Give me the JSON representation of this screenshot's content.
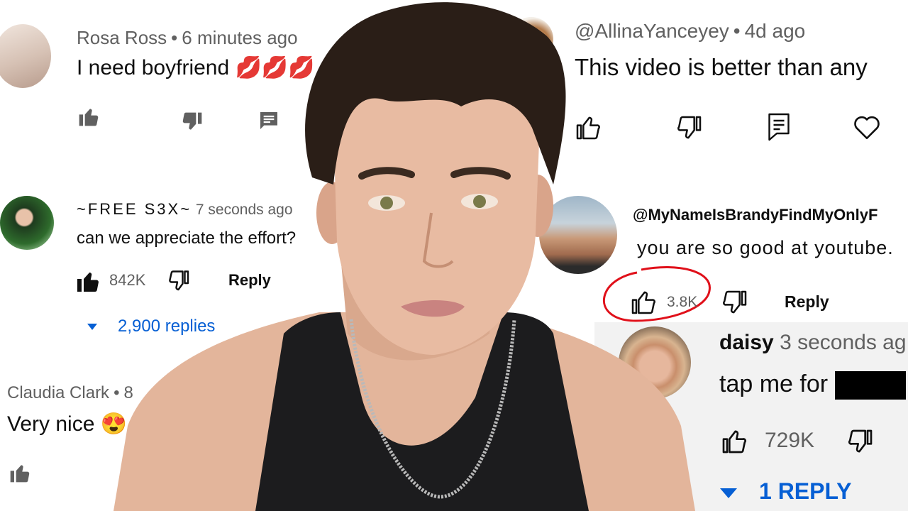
{
  "comments": {
    "c1": {
      "author": "Rosa Ross",
      "time": "6 minutes ago",
      "text": "I need boyfriend",
      "emoji": "💋💋💋"
    },
    "c2": {
      "author": "~FREE S3X~",
      "time": "7 seconds ago",
      "text": "can we appreciate the effort?",
      "likes": "842K",
      "reply_label": "Reply",
      "replies_label": "2,900 replies"
    },
    "c3": {
      "author": "Claudia Clark",
      "time": "8",
      "text": "Very nice",
      "emoji": "😍"
    },
    "c4": {
      "author": "@AllinaYanceyey",
      "time": "4d ago",
      "text": "This video is better than any"
    },
    "c5": {
      "author": "@MyNameIsBrandyFindMyOnlyF",
      "text": "you are so good at youtube.",
      "likes": "3.8K",
      "reply_label": "Reply"
    },
    "c6": {
      "author": "daisy",
      "time": "3 seconds ag",
      "text": "tap me for",
      "likes": "729K",
      "replies_label": "1 REPLY"
    }
  },
  "separator": "•",
  "colors": {
    "link_blue": "#065fd4",
    "highlight_red": "#e0101a",
    "meta_gray": "#606060",
    "skin": "#e3b59b",
    "hair": "#2a1e17",
    "tank_top": "#1c1c1e"
  }
}
